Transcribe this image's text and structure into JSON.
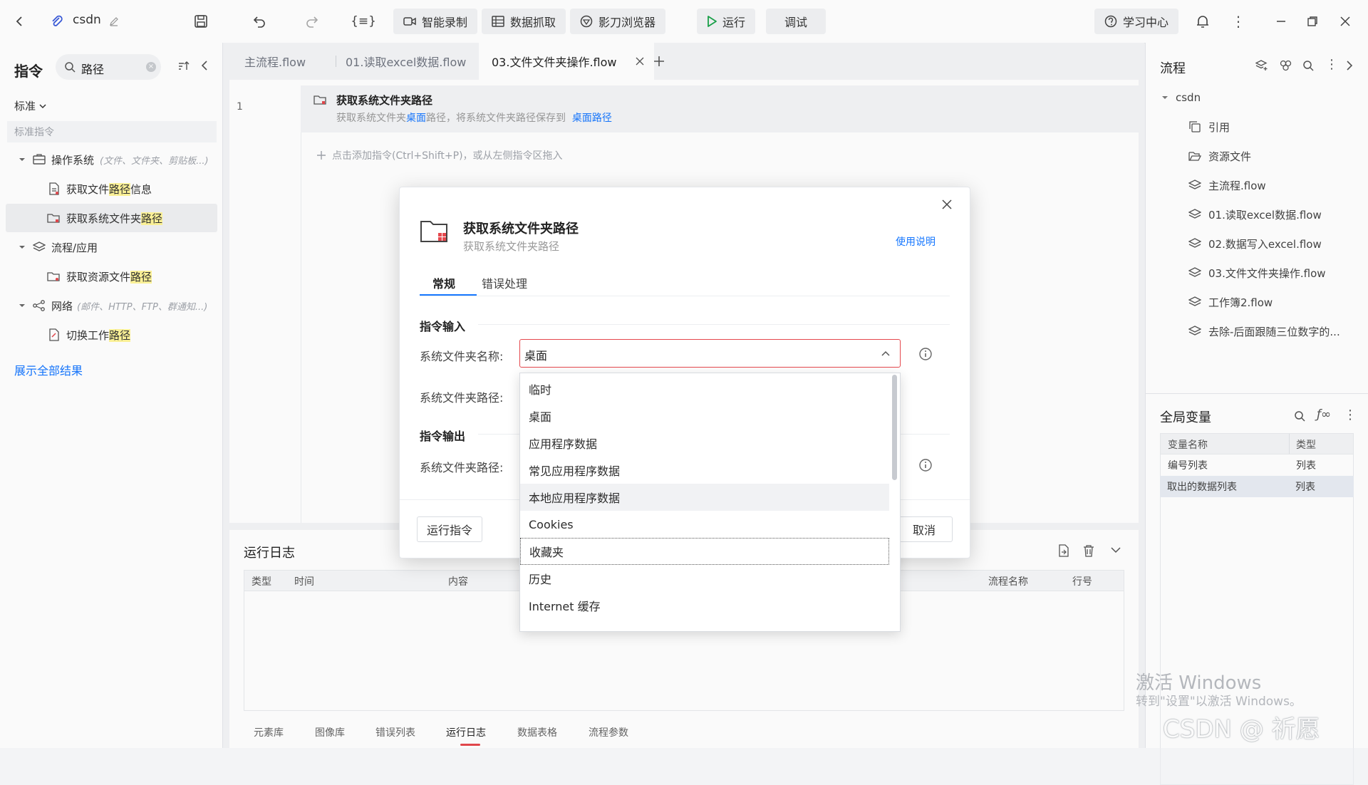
{
  "topbar": {
    "project_name": "csdn",
    "buttons": [
      {
        "label": "智能录制",
        "icon": "camera-icon"
      },
      {
        "label": "数据抓取",
        "icon": "table-icon"
      },
      {
        "label": "影刀浏览器",
        "icon": "browser-icon"
      },
      {
        "label": "运行",
        "icon": "play-icon"
      },
      {
        "label": "调试",
        "icon": ""
      }
    ],
    "learning_center": "学习中心"
  },
  "left": {
    "title": "指令",
    "search_value": "路径",
    "filter": "标准",
    "section_label": "标准指令",
    "tree": [
      {
        "label": "操作系统",
        "hint": "(文件、文件夹、剪贴板...)",
        "icon": "system-icon"
      },
      {
        "label_pre": "获取文件",
        "label_hl": "路径",
        "label_post": "信息",
        "icon": "file-info-icon"
      },
      {
        "label_pre": "获取系统文件夹",
        "label_hl": "路径",
        "label_post": "",
        "icon": "folder-icon"
      },
      {
        "label": "流程/应用",
        "hint": "",
        "icon": "layers-icon"
      },
      {
        "label_pre": "获取资源文件",
        "label_hl": "路径",
        "label_post": "",
        "icon": "folder-icon"
      },
      {
        "label": "网络",
        "hint": "(邮件、HTTP、FTP、群通知...)",
        "icon": "share-icon"
      },
      {
        "label_pre": "切换工作",
        "label_hl": "路径",
        "label_post": "",
        "icon": "switch-icon"
      }
    ],
    "show_all": "展示全部结果"
  },
  "tabs": [
    {
      "label": "主流程.flow"
    },
    {
      "label": "01.读取excel数据.flow"
    },
    {
      "label": "03.文件文件夹操作.flow",
      "active": true
    }
  ],
  "editor": {
    "line_number": "1",
    "step_title": "获取系统文件夹路径",
    "step_desc_1": "获取系统文件夹",
    "step_desc_link1": "桌面",
    "step_desc_2": "路径，将系统文件夹路径保存到",
    "step_desc_link2": "桌面路径",
    "add_hint": "点击添加指令(Ctrl+Shift+P)，或从左侧指令区拖入"
  },
  "log": {
    "title": "运行日志",
    "columns": [
      "类型",
      "时间",
      "内容",
      "流程名称",
      "行号"
    ],
    "bottom_tabs": [
      "元素库",
      "图像库",
      "错误列表",
      "运行日志",
      "数据表格",
      "流程参数"
    ],
    "active_tab": "运行日志"
  },
  "right": {
    "title": "流程",
    "root": "csdn",
    "items": [
      {
        "label": "引用",
        "icon": "copy-icon"
      },
      {
        "label": "资源文件",
        "icon": "folder-open-icon"
      },
      {
        "label": "主流程.flow",
        "icon": "layers-icon"
      },
      {
        "label": "01.读取excel数据.flow",
        "icon": "layers-icon"
      },
      {
        "label": "02.数据写入excel.flow",
        "icon": "layers-icon"
      },
      {
        "label": "03.文件文件夹操作.flow",
        "icon": "layers-icon"
      },
      {
        "label": "工作簿2.flow",
        "icon": "layers-icon"
      },
      {
        "label": "去除-后面跟随三位数字的...",
        "icon": "layers-icon"
      }
    ],
    "vars_title": "全局变量",
    "vars_columns": [
      "变量名称",
      "类型"
    ],
    "vars_rows": [
      [
        "编号列表",
        "列表"
      ],
      [
        "取出的数据列表",
        "列表"
      ]
    ]
  },
  "dialog": {
    "title": "获取系统文件夹路径",
    "subtitle": "获取系统文件夹路径",
    "help_link": "使用说明",
    "tabs": [
      "常规",
      "错误处理"
    ],
    "section_input": "指令输入",
    "field1_label": "系统文件夹名称:",
    "field1_value": "桌面",
    "field2_label": "系统文件夹路径:",
    "section_output": "指令输出",
    "field3_label": "系统文件夹路径:",
    "run_button": "运行指令",
    "cancel_button": "取消",
    "dropdown_options": [
      "临时",
      "桌面",
      "应用程序数据",
      "常见应用程序数据",
      "本地应用程序数据",
      "Cookies",
      "收藏夹",
      "历史",
      "Internet 缓存"
    ]
  },
  "watermark": {
    "line1": "激活 Windows",
    "line2": "转到\"设置\"以激活 Windows。",
    "csdn": "CSDN @ 祈愿"
  },
  "colors": {
    "accent": "#1677ff",
    "play": "#1aa34a",
    "highlight": "#fff59a",
    "danger": "#e5484d"
  }
}
